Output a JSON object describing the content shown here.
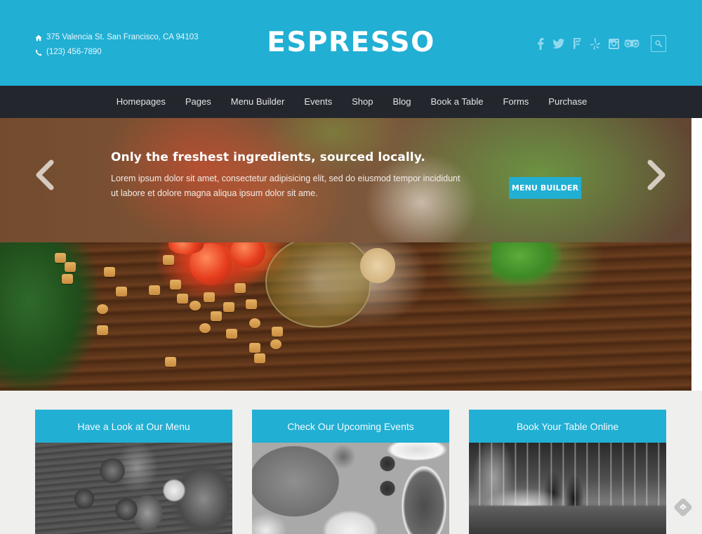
{
  "header": {
    "address": "375 Valencia St. San Francisco, CA 94103",
    "address_icon": "home-icon",
    "phone": "(123) 456-7890",
    "phone_icon": "phone-icon",
    "logo": "ESPRESSO",
    "social": [
      {
        "name": "facebook-icon"
      },
      {
        "name": "twitter-icon"
      },
      {
        "name": "foursquare-icon"
      },
      {
        "name": "yelp-icon"
      },
      {
        "name": "instagram-icon"
      },
      {
        "name": "tripadvisor-icon"
      }
    ],
    "search_icon": "search-icon"
  },
  "nav": {
    "items": [
      "Homepages",
      "Pages",
      "Menu Builder",
      "Events",
      "Shop",
      "Blog",
      "Book a Table",
      "Forms",
      "Purchase"
    ]
  },
  "hero": {
    "title": "Only the freshest ingredients, sourced locally.",
    "text": "Lorem ipsum dolor sit amet, consectetur adipisicing elit, sed do eiusmod tempor incididunt ut labore et dolore magna aliqua ipsum dolor sit ame.",
    "button_label": "MENU BUILDER",
    "prev_icon": "chevron-left-icon",
    "next_icon": "chevron-right-icon"
  },
  "cards": [
    {
      "title": "Have a Look at Our Menu"
    },
    {
      "title": "Check Our Upcoming Events"
    },
    {
      "title": "Book Your Table Online"
    }
  ],
  "floating_badge": "feedly-icon",
  "colors": {
    "brand": "#21afd4",
    "nav_bg": "#23272d",
    "page_bg": "#efefed"
  }
}
